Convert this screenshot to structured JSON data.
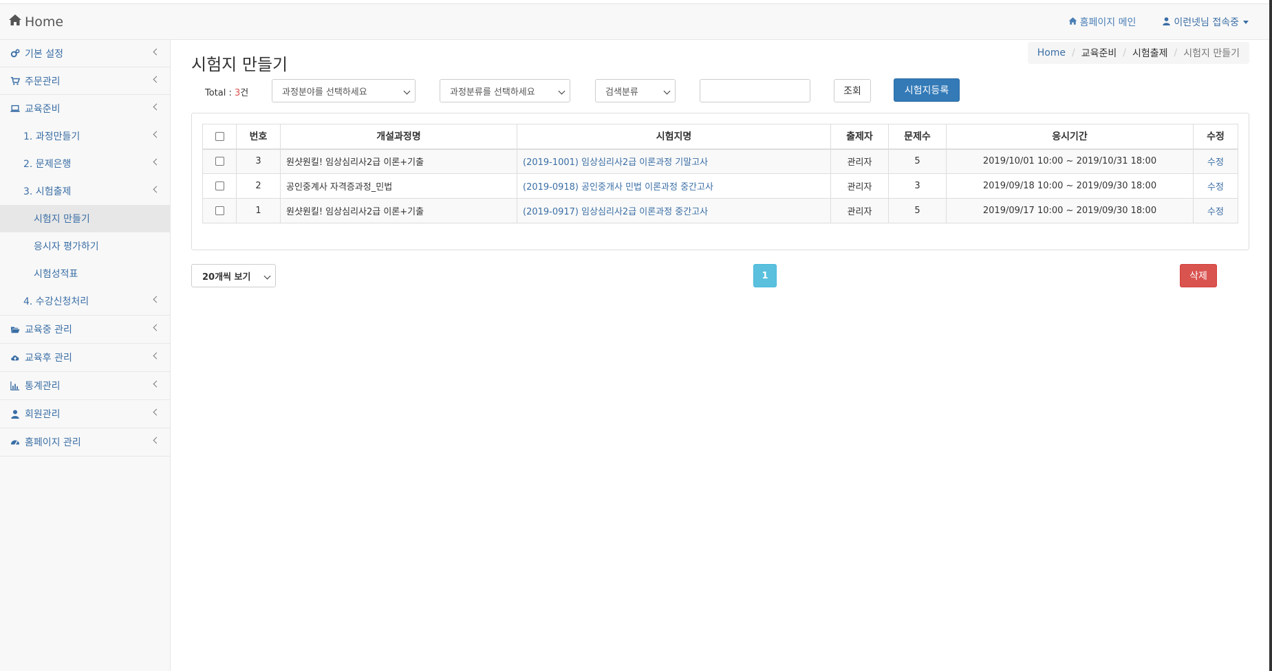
{
  "navbar": {
    "brand": "Home",
    "homepage_link": "홈페이지 메인",
    "user_menu": "이런넷님 접속중"
  },
  "sidebar": {
    "items": [
      {
        "label": "기본 설정",
        "icon": "gears-icon"
      },
      {
        "label": "주문관리",
        "icon": "cart-icon"
      },
      {
        "label": "교육준비",
        "icon": "laptop-icon"
      }
    ],
    "sub_items": [
      {
        "label": "1. 과정만들기"
      },
      {
        "label": "2. 문제은행"
      },
      {
        "label": "3. 시험출제"
      }
    ],
    "sub3_items": [
      {
        "label": "시험지 만들기"
      },
      {
        "label": "응시자 평가하기"
      },
      {
        "label": "시험성적표"
      }
    ],
    "sub_item_4": "4. 수강신청처리",
    "bottom_items": [
      {
        "label": "교육중 관리",
        "icon": "folder-open-icon"
      },
      {
        "label": "교육후 관리",
        "icon": "cloud-upload-icon"
      },
      {
        "label": "통계관리",
        "icon": "bar-chart-icon"
      },
      {
        "label": "회원관리",
        "icon": "user-icon"
      },
      {
        "label": "홈페이지 관리",
        "icon": "dashboard-icon"
      }
    ]
  },
  "page": {
    "title": "시험지 만들기",
    "breadcrumb": [
      "Home",
      "교육준비",
      "시험출제",
      "시험지 만들기"
    ]
  },
  "filters": {
    "total_label": "Total : ",
    "total_count": "3",
    "total_unit": "건",
    "field_select": "과정분야를 선택하세요",
    "category_select": "과정분류를 선택하세요",
    "search_type_select": "검색분류",
    "search_value": "",
    "search_button": "조회",
    "register_button": "시험지등록"
  },
  "table": {
    "headers": [
      "번호",
      "개설과정명",
      "시험지명",
      "출제자",
      "문제수",
      "응시기간",
      "수정"
    ],
    "rows": [
      {
        "no": "3",
        "course": "원샷원킬! 임상심리사2급 이론+기출",
        "exam": "(2019-1001) 임상심리사2급 이론과정 기말고사",
        "author": "관리자",
        "count": "5",
        "period": "2019/10/01 10:00 ~ 2019/10/31 18:00",
        "edit": "수정"
      },
      {
        "no": "2",
        "course": "공인중계사 자격증과정_민법",
        "exam": "(2019-0918) 공인중개사 민법 이론과정 중간고사",
        "author": "관리자",
        "count": "3",
        "period": "2019/09/18 10:00 ~ 2019/09/30 18:00",
        "edit": "수정"
      },
      {
        "no": "1",
        "course": "원샷원킬! 임상심리사2급 이론+기출",
        "exam": "(2019-0917) 임상심리사2급 이론과정 중간고사",
        "author": "관리자",
        "count": "5",
        "period": "2019/09/17 10:00 ~ 2019/09/30 18:00",
        "edit": "수정"
      }
    ]
  },
  "footer": {
    "per_page": "20개씩 보기",
    "current_page": "1",
    "delete_button": "삭제"
  },
  "colors": {
    "link": "#3a6ea5",
    "primary": "#337ab7",
    "danger": "#d9534f",
    "info": "#5bc0de"
  }
}
